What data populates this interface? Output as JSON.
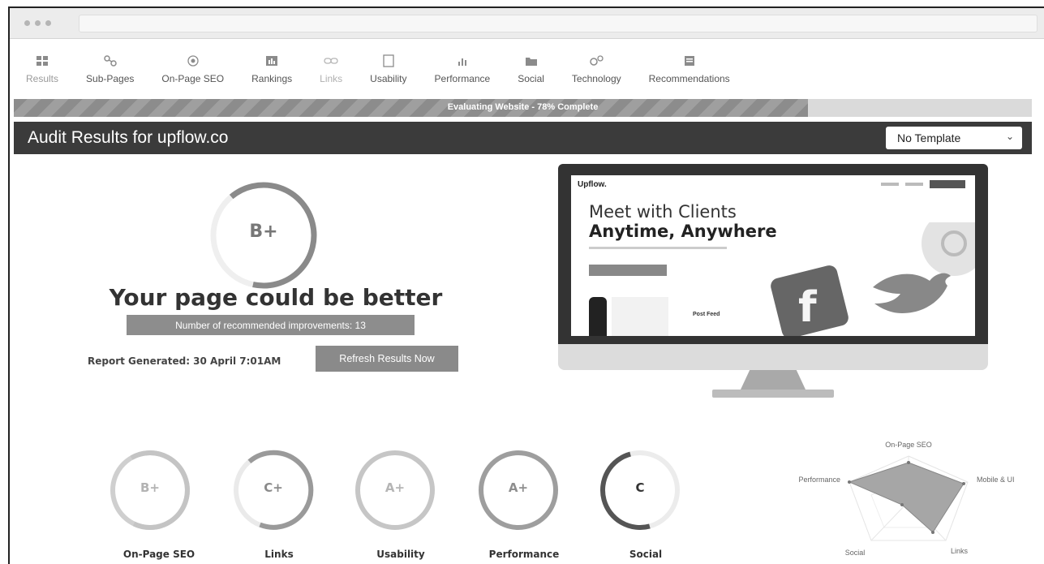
{
  "tabs": [
    {
      "label": "Results",
      "icon": "results-grid-icon"
    },
    {
      "label": "Sub-Pages",
      "icon": "sub-pages-icon"
    },
    {
      "label": "On-Page SEO",
      "icon": "on-page-seo-icon"
    },
    {
      "label": "Rankings",
      "icon": "rankings-icon"
    },
    {
      "label": "Links",
      "icon": "links-icon"
    },
    {
      "label": "Usability",
      "icon": "usability-icon"
    },
    {
      "label": "Performance",
      "icon": "performance-icon"
    },
    {
      "label": "Social",
      "icon": "social-icon"
    },
    {
      "label": "Technology",
      "icon": "technology-icon"
    },
    {
      "label": "Recommendations",
      "icon": "recommendations-icon"
    }
  ],
  "progress": {
    "text": "Evaluating Website - 78% Complete",
    "percent": 78
  },
  "header": {
    "title": "Audit Results for upflow.co",
    "template_select": "No Template"
  },
  "overall": {
    "grade": "B+",
    "headline": "Your page could be better",
    "improvements_label": "Number of recommended improvements: 13",
    "report_generated": "Report Generated: 30 April 7:01AM",
    "refresh_label": "Refresh Results Now"
  },
  "preview": {
    "logo": "Upflow.",
    "headline_line1": "Meet with Clients",
    "headline_line2": "Anytime, Anywhere",
    "feed_label": "Post Feed"
  },
  "scores": [
    {
      "label": "On-Page SEO",
      "grade": "B+"
    },
    {
      "label": "Links",
      "grade": "C+"
    },
    {
      "label": "Usability",
      "grade": "A+"
    },
    {
      "label": "Performance",
      "grade": "A+"
    },
    {
      "label": "Social",
      "grade": "C"
    }
  ],
  "radar": {
    "axes": [
      "On-Page SEO",
      "Mobile & UI",
      "Links",
      "Social",
      "Performance"
    ]
  },
  "colors": {
    "header_bg": "#3b3b3b",
    "button_gray": "#8a8a8a",
    "progress_fill": "#8c8c8c"
  }
}
